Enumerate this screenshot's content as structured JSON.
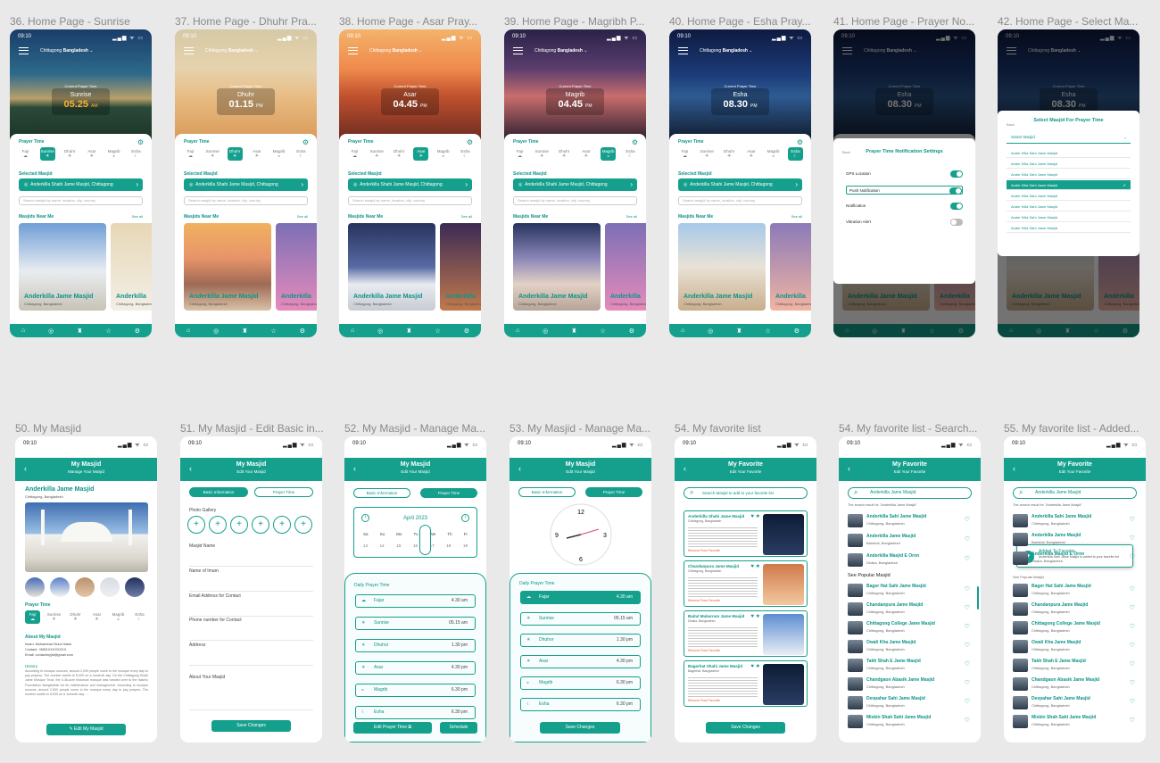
{
  "status": {
    "time": "09:10",
    "icons": "▂▄▆ ᯤ ▭"
  },
  "labels": {
    "l36": "36. Home Page - Sunrise",
    "l37": "37. Home Page - Dhuhr Pra...",
    "l38": "38. Home Page - Asar Pray...",
    "l39": "39. Home Page - Magribh P...",
    "l40": "40. Home Page - Esha Pray...",
    "l41": "41. Home Page - Prayer No...",
    "l42": "42. Home Page - Select Ma...",
    "l50": "50. My Masjid",
    "l51": "51. My Masjid - Edit Basic in...",
    "l52": "52. My Masjid - Manage Ma...",
    "l53": "53. My Masjid - Manage Ma...",
    "l54": "54. My favorite list",
    "l54b": "54. My favorite list - Search...",
    "l55": "55. My favorite list - Added..."
  },
  "home": {
    "location_city": "Chittagong",
    "location_country": "Bangladesh",
    "current_label": "Current Prayer Time",
    "prayer_time_title": "Prayer Time",
    "prayers": [
      "Fajr",
      "Sunrise",
      "Dhuhr",
      "Asar",
      "Magrib",
      "Esha"
    ],
    "selected_masjid_title": "Selected Masjid",
    "selected_masjid": "Anderkilla Shahi Jame Masjid, Chittagong",
    "search_placeholder": "Search masjid by name, location, city, country",
    "near_title": "Masjids Near Me",
    "see_all": "See all",
    "card_name": "Anderkilla Jame Masjid",
    "card_loc": "Chittagong, Bangladesh",
    "card_name_short": "Anderkilla",
    "screens": [
      {
        "name": "Sunrise",
        "time": "05.25",
        "ampm": "AM"
      },
      {
        "name": "Dhuhr",
        "time": "01.15",
        "ampm": "PM"
      },
      {
        "name": "Asar",
        "time": "04.45",
        "ampm": "PM"
      },
      {
        "name": "Magrib",
        "time": "04.45",
        "ampm": "PM"
      },
      {
        "name": "Esha",
        "time": "08.30",
        "ampm": "PM"
      },
      {
        "name": "Esha",
        "time": "08.30",
        "ampm": "PM"
      },
      {
        "name": "Esha",
        "time": "08.30",
        "ampm": "PM"
      }
    ]
  },
  "notif": {
    "back": "Back",
    "title": "Prayer Time Notification Settings",
    "rows": [
      "GPS Location",
      "Push Notification",
      "Notification",
      "Vibration Alert"
    ]
  },
  "selmodal": {
    "back": "Back",
    "title": "Select Masjid For Prayer Time",
    "dropdown": "Select Masjid",
    "items": [
      "Ander Killa Sahi Jame Masjid",
      "Ander Killa Sahi Jame Masjid",
      "Ander Killa Sahi Jame Masjid",
      "Ander Killa Sahi Jame Masjid",
      "Ander Killa Sahi Jame Masjid",
      "Ander Killa Sahi Jame Masjid",
      "Ander Killa Sahi Jame Masjid",
      "Ander Killa Sahi Jame Masjid"
    ]
  },
  "mymasjid": {
    "title": "My Masjid",
    "subtitle": "Manage Your Masjid",
    "edit_subtitle": "Edit Your Masjid",
    "name": "Anderkilla Jame Masjid",
    "loc": "Chittagong, Bangladesh",
    "about": "About My Masjid",
    "imam": "Imam: Mohammad Nurul Islam",
    "contact": "Contact: +8801XXXXXXXX",
    "email": "Email: contactmyjid@gmail.com",
    "history": "History",
    "history_text": "According to mosque sources, around 2,000 people come to the mosque every day to pay prayers. The number swells to 6,000 on a Juma'ah day. On the Chittagong Shahi Jame Mosque Trust, the 4.48-acre historical mosque was handed over to the Islamic Foundation Bangladesh for its maintenance and management. According to mosque sources, around 2,000 people come to the mosque every day to pay prayers. The number swells to 6,000 on a Juma'ah day. ...",
    "read_more": "Read More",
    "edit_btn": "Edit My Masjid",
    "basic_tab": "Basic Information",
    "prayer_tab": "Prayer Time",
    "photo_gallery": "Photo Gallery",
    "fields": [
      "Masjid Name",
      "Name of Imam",
      "Email Address for Contact",
      "Phone number for Contact",
      "Address",
      "About Your Masjid"
    ],
    "save": "Save Changes",
    "month": "April 2023",
    "weekdays": [
      "Sa",
      "Su",
      "Mo",
      "Tu",
      "We",
      "Th",
      "Fr"
    ],
    "dates": [
      "13",
      "14",
      "15",
      "16",
      "17",
      "18",
      "19"
    ],
    "daily_title": "Daily Prayer Time",
    "daily": [
      {
        "n": "Fajar",
        "t": "4.30 am"
      },
      {
        "n": "Sunrise",
        "t": "05.15 am"
      },
      {
        "n": "Dhuhor",
        "t": "1.30 pm"
      },
      {
        "n": "Asar",
        "t": "4.30 pm"
      },
      {
        "n": "Magrib",
        "t": "6.30 pm"
      },
      {
        "n": "Esha",
        "t": "6.30 pm"
      }
    ],
    "edit_prayer": "Edit Prayer Time",
    "schedule": "Schedule"
  },
  "fav": {
    "title": "My Favorite",
    "subtitle": "Edit Your Favorite",
    "search_placeholder": "Search Masjid to add to your favorite list",
    "search_value": "Anderkilla Jame Masjid",
    "result_note": "The search result for \"Anderkilla Jame Masjid\"",
    "cards": [
      {
        "n": "Anderkilla Shahi Jame Masjid",
        "s": "Chittagong, Bangladesh"
      },
      {
        "n": "Chandanpura Jame Masjid",
        "s": "Chittagong, Bangladesh"
      },
      {
        "n": "Baitul Mukarram Jame Masjid",
        "s": "Dhaka, Bangladesh"
      },
      {
        "n": "Bagerhat Shahi Jame Masjid",
        "s": "Bagerhat, Bangladesh"
      }
    ],
    "card_link": "Remove From Favorite",
    "card_link2": "Remove From Favorite",
    "results": [
      {
        "n": "Anderkilla Sahi Jame Masjid",
        "s": "Chittagong, Bangladesh"
      },
      {
        "n": "Anderkilla Jame Masjid",
        "s": "Barishal, Bangladesh"
      },
      {
        "n": "Anderkilla Masjid E Ornn",
        "s": "Dhaka, Bangladesh"
      }
    ],
    "popular_title": "See Popular Masjid",
    "popular": [
      {
        "n": "Bager Hat Sahi Jame Masjid",
        "s": "Chittagong, Bangladesh"
      },
      {
        "n": "Chandanpura Jame Masjid",
        "s": "Chittagong, Bangladesh"
      },
      {
        "n": "Chittagong College Jame Masjid",
        "s": "Chittagong, Bangladesh"
      },
      {
        "n": "Owali Kha Jame Masjid",
        "s": "Chittagong, Bangladesh"
      },
      {
        "n": "Takh Shah E Jame Masjid",
        "s": "Chittagong, Bangladesh"
      },
      {
        "n": "Chandgaon Abasik Jame Masjid",
        "s": "Chittagong, Bangladesh"
      },
      {
        "n": "Devpahar Sahi Jame Masjid",
        "s": "Chittagong, Bangladesh"
      },
      {
        "n": "Miskin Shah Sahi Jame Masjid",
        "s": "Chittagong, Bangladesh"
      }
    ],
    "toast_title": "Added To Favorite",
    "toast_text": "Anderkilla Sahi Jame Masjid is added to your favorite list"
  },
  "colors": {
    "teal": "#14a08c",
    "bg": "#e9e9e9"
  }
}
